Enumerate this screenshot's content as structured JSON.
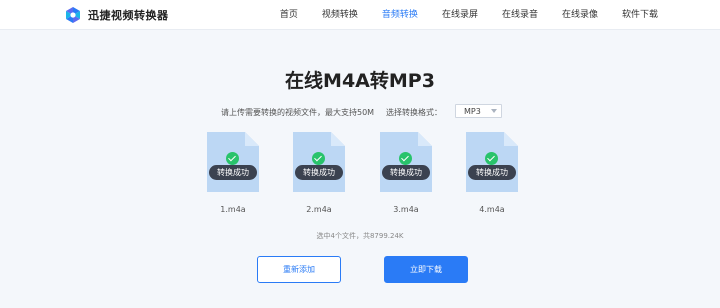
{
  "header": {
    "logo_text": "迅捷视频转换器",
    "nav": [
      {
        "label": "首页"
      },
      {
        "label": "视频转换"
      },
      {
        "label": "音频转换",
        "active": true
      },
      {
        "label": "在线录屏"
      },
      {
        "label": "在线录音"
      },
      {
        "label": "在线录像"
      },
      {
        "label": "软件下载"
      }
    ]
  },
  "page_title": "在线M4A转MP3",
  "options": {
    "upload_tip": "请上传需要转换的视频文件，最大支持50M",
    "format_label": "选择转换格式：",
    "format_value": "MP3"
  },
  "files": [
    {
      "name": "1.m4a",
      "status": "转换成功"
    },
    {
      "name": "2.m4a",
      "status": "转换成功"
    },
    {
      "name": "3.m4a",
      "status": "转换成功"
    },
    {
      "name": "4.m4a",
      "status": "转换成功"
    }
  ],
  "summary": "选中4个文件，共8799.24K",
  "buttons": {
    "readd_label": "重新添加",
    "download_label": "立即下载"
  },
  "colors": {
    "accent": "#2a7bf6",
    "success": "#28c36b",
    "file_icon": "#bcd7f4"
  }
}
